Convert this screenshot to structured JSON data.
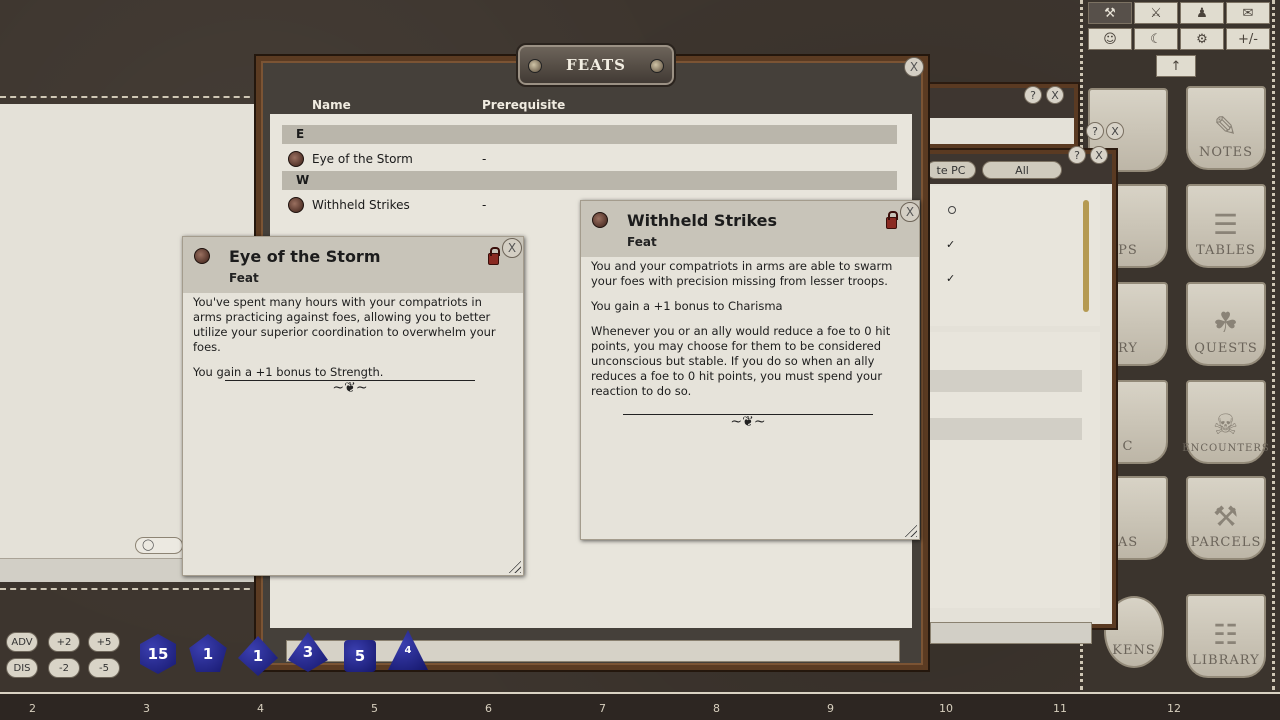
{
  "feats_window": {
    "title": "FEATS",
    "columns": {
      "name": "Name",
      "prerequisite": "Prerequisite"
    },
    "groups": [
      {
        "letter": "E",
        "feats": [
          {
            "name": "Eye of the Storm",
            "prerequisite": "-"
          }
        ]
      },
      {
        "letter": "W",
        "feats": [
          {
            "name": "Withheld Strikes",
            "prerequisite": "-"
          }
        ]
      }
    ],
    "close_label": "X"
  },
  "card_eye": {
    "title": "Eye of the Storm",
    "subtitle": "Feat",
    "para1": "You've spent many hours with your compatriots in arms practicing against foes, allowing you to better utilize your superior coordination to overwhelm your foes.",
    "para2": "You gain a +1 bonus to Strength.",
    "ornament": "~❦~",
    "close_label": "X"
  },
  "card_withheld": {
    "title": "Withheld Strikes",
    "subtitle": "Feat",
    "para1": "You and your compatriots in arms are able to swarm your foes with precision missing from lesser troops.",
    "para2": "You gain a +1 bonus to Charisma",
    "para3": "Whenever you or an ally would reduce a foe to 0 hit points, you may choose for them to be considered unconscious but stable. If you do so when an ally reduces a foe to 0 hit points, you must spend your reaction to do so.",
    "ornament": "~❦~",
    "close_label": "X"
  },
  "bg_window": {
    "filter_pc_label": "te PC",
    "filter_all_label": "All",
    "help_label": "?",
    "close_label": "X"
  },
  "sidebar": {
    "tool_icons": [
      "⚒",
      "⚔",
      "♟",
      "✉",
      "☺",
      "☾",
      "⚙",
      "+/-"
    ],
    "pin_icon": "↑",
    "shields": [
      {
        "label": "NOTES",
        "glyph": "✎"
      },
      {
        "label": "TABLES",
        "glyph": "☰"
      },
      {
        "label": "QUESTS",
        "glyph": "☘"
      },
      {
        "label": "ENCOUNTERS",
        "glyph": "☠"
      },
      {
        "label": "PARCELS",
        "glyph": "⚒"
      },
      {
        "label": "LIBRARY",
        "glyph": "☷"
      }
    ],
    "partial_labels": [
      "PS",
      "RY",
      "C",
      "AS",
      "KENS"
    ]
  },
  "modifiers": {
    "adv": "ADV",
    "dis": "DIS",
    "plus2": "+2",
    "plus5": "+5",
    "minus2": "-2",
    "minus5": "-5"
  },
  "dice": {
    "d20": "15",
    "d12": "1",
    "d10": "1",
    "d8": "3",
    "d6": "5",
    "d4": "4"
  },
  "ruler_ticks": [
    "2",
    "3",
    "4",
    "5",
    "6",
    "7",
    "8",
    "9",
    "10",
    "11",
    "12"
  ]
}
